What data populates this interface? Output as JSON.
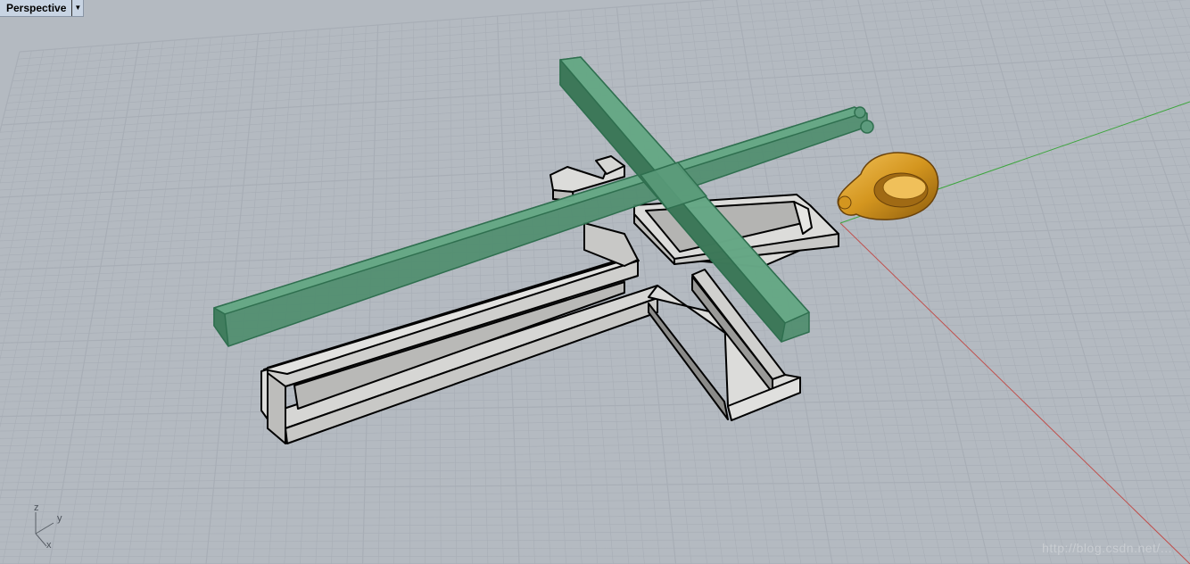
{
  "viewport": {
    "title": "Perspective",
    "menu_icon": "triangle-down-icon"
  },
  "axis_widget": {
    "z": "z",
    "y": "y",
    "x": "x"
  },
  "colors": {
    "background": "#b4bac1",
    "grid": "#a8aeb6",
    "x_axis": "#c0504d",
    "y_axis": "#3da53d",
    "selected_object": "#5d9b7d",
    "rendered_object": "#c8c8c6",
    "ring": "#d4961f"
  },
  "watermark": "http://blog.csdn.net/..."
}
